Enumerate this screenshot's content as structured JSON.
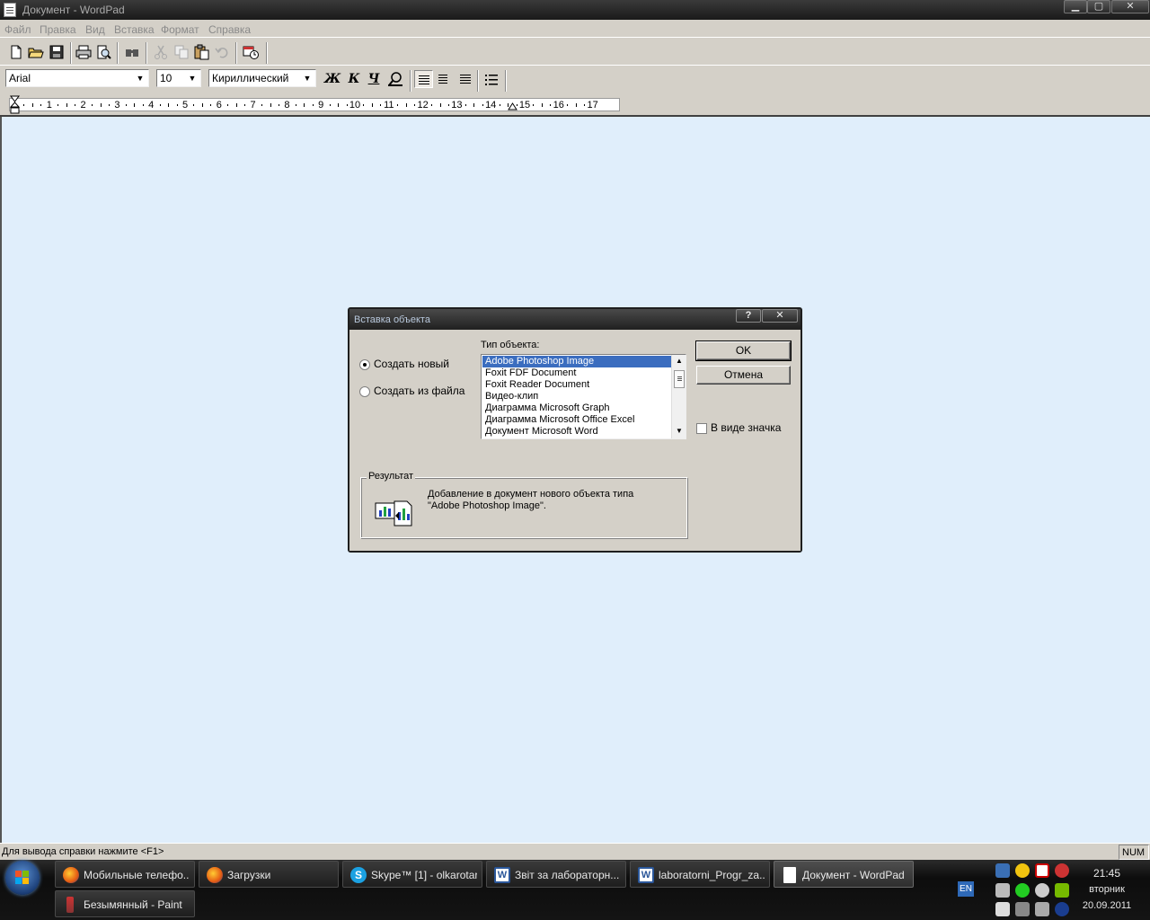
{
  "window": {
    "title": "Документ - WordPad",
    "controls": {
      "minimize": "▁",
      "maximize": "▢",
      "close": "✕"
    }
  },
  "menu": [
    "Файл",
    "Правка",
    "Вид",
    "Вставка",
    "Формат",
    "Справка"
  ],
  "toolbar": {
    "icons": [
      "new-document-icon",
      "open-folder-icon",
      "save-icon",
      "print-icon",
      "print-preview-icon",
      "find-icon",
      "cut-icon",
      "copy-icon",
      "paste-icon",
      "undo-icon",
      "insert-datetime-icon"
    ]
  },
  "format_bar": {
    "font_name": "Arial",
    "font_size": "10",
    "script": "Кириллический",
    "bold": "Ж",
    "italic": "К",
    "underline": "Ч",
    "align_left_active": true
  },
  "ruler": {
    "numbers": [
      "1",
      "2",
      "3",
      "4",
      "5",
      "6",
      "7",
      "8",
      "9",
      "10",
      "11",
      "12",
      "13",
      "14",
      "15",
      "16",
      "17"
    ]
  },
  "status": {
    "help_text": "Для вывода справки нажмите <F1>",
    "num": "NUM"
  },
  "dialog": {
    "title": "Вставка объекта",
    "help_btn": "?",
    "close_btn": "✕",
    "radio_new": "Создать новый",
    "radio_from_file": "Создать из файла",
    "object_type_label": "Тип объекта:",
    "object_types": [
      "Adobe Photoshop Image",
      "Foxit FDF Document",
      "Foxit Reader Document",
      "Видео-клип",
      "Диаграмма Microsoft Graph",
      "Диаграмма Microsoft Office Excel",
      "Документ Microsoft Word"
    ],
    "selected_index": 0,
    "ok": "OK",
    "cancel": "Отмена",
    "as_icon": "В виде значка",
    "result_legend": "Результат",
    "result_line1": "Добавление в документ нового объекта типа",
    "result_line2": "\"Adobe Photoshop Image\"."
  },
  "taskbar": {
    "tasks": [
      {
        "label": "Мобильные телефо...",
        "icon": "firefox-icon"
      },
      {
        "label": "Загрузки",
        "icon": "firefox-icon"
      },
      {
        "label": "Skype™ [1] - olkarotar",
        "icon": "skype-icon"
      },
      {
        "label": "Звіт  за лабораторн...",
        "icon": "word-icon"
      },
      {
        "label": "laboratorni_Progr_za...",
        "icon": "word-icon"
      },
      {
        "label": "Документ - WordPad",
        "icon": "wordpad-icon"
      },
      {
        "label": "Безымянный - Paint",
        "icon": "paint-icon"
      }
    ],
    "language": "EN",
    "clock": {
      "time": "21:45",
      "day": "вторник",
      "date": "20.09.2011"
    }
  },
  "colors": {
    "document_bg": "#e0eefb",
    "selection": "#3b6dbf",
    "chrome": "#d4d0c8"
  }
}
